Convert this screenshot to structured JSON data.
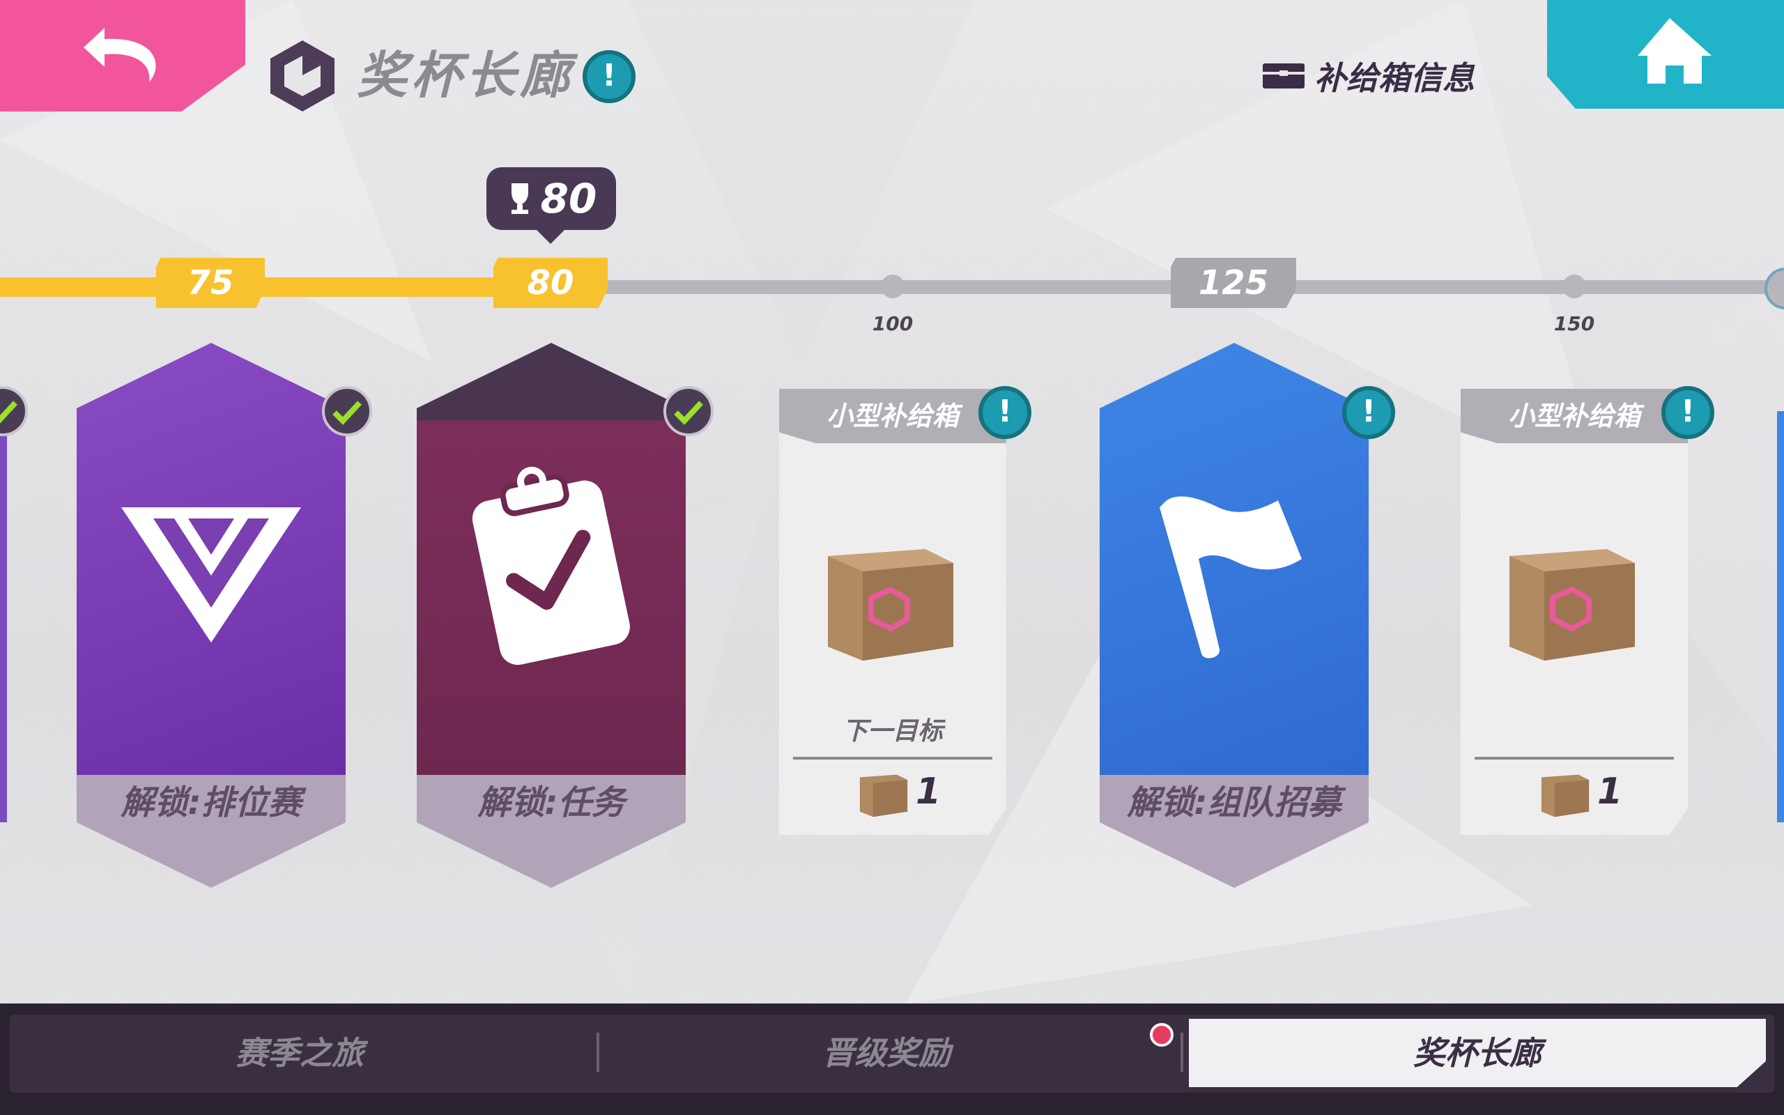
{
  "header": {
    "title": "奖杯长廊",
    "info_mark": "!",
    "supply_info_label": "补给箱信息"
  },
  "progress": {
    "current_trophies": "80",
    "milestones": [
      "75",
      "80",
      "125"
    ],
    "small_marks": [
      "100",
      "150"
    ]
  },
  "rewards": [
    {
      "label": "解锁:排位赛",
      "completed": true,
      "color": "#7a3fb0",
      "icon": "ranked-emblem-icon"
    },
    {
      "label": "解锁:任务",
      "completed": true,
      "color": "#7c2e5a",
      "icon": "clipboard-check-icon"
    },
    {
      "title": "小型补给箱",
      "next_goal": "下一目标",
      "count": "1",
      "icon": "supply-box-icon"
    },
    {
      "label": "解锁:组队招募",
      "completed": false,
      "color": "#3a78d8",
      "icon": "flag-icon"
    },
    {
      "title": "小型补给箱",
      "count": "1",
      "icon": "supply-box-icon"
    }
  ],
  "tabs": [
    {
      "label": "赛季之旅",
      "active": false
    },
    {
      "label": "晋级奖励",
      "active": false,
      "has_notification": true
    },
    {
      "label": "奖杯长廊",
      "active": true
    }
  ]
}
